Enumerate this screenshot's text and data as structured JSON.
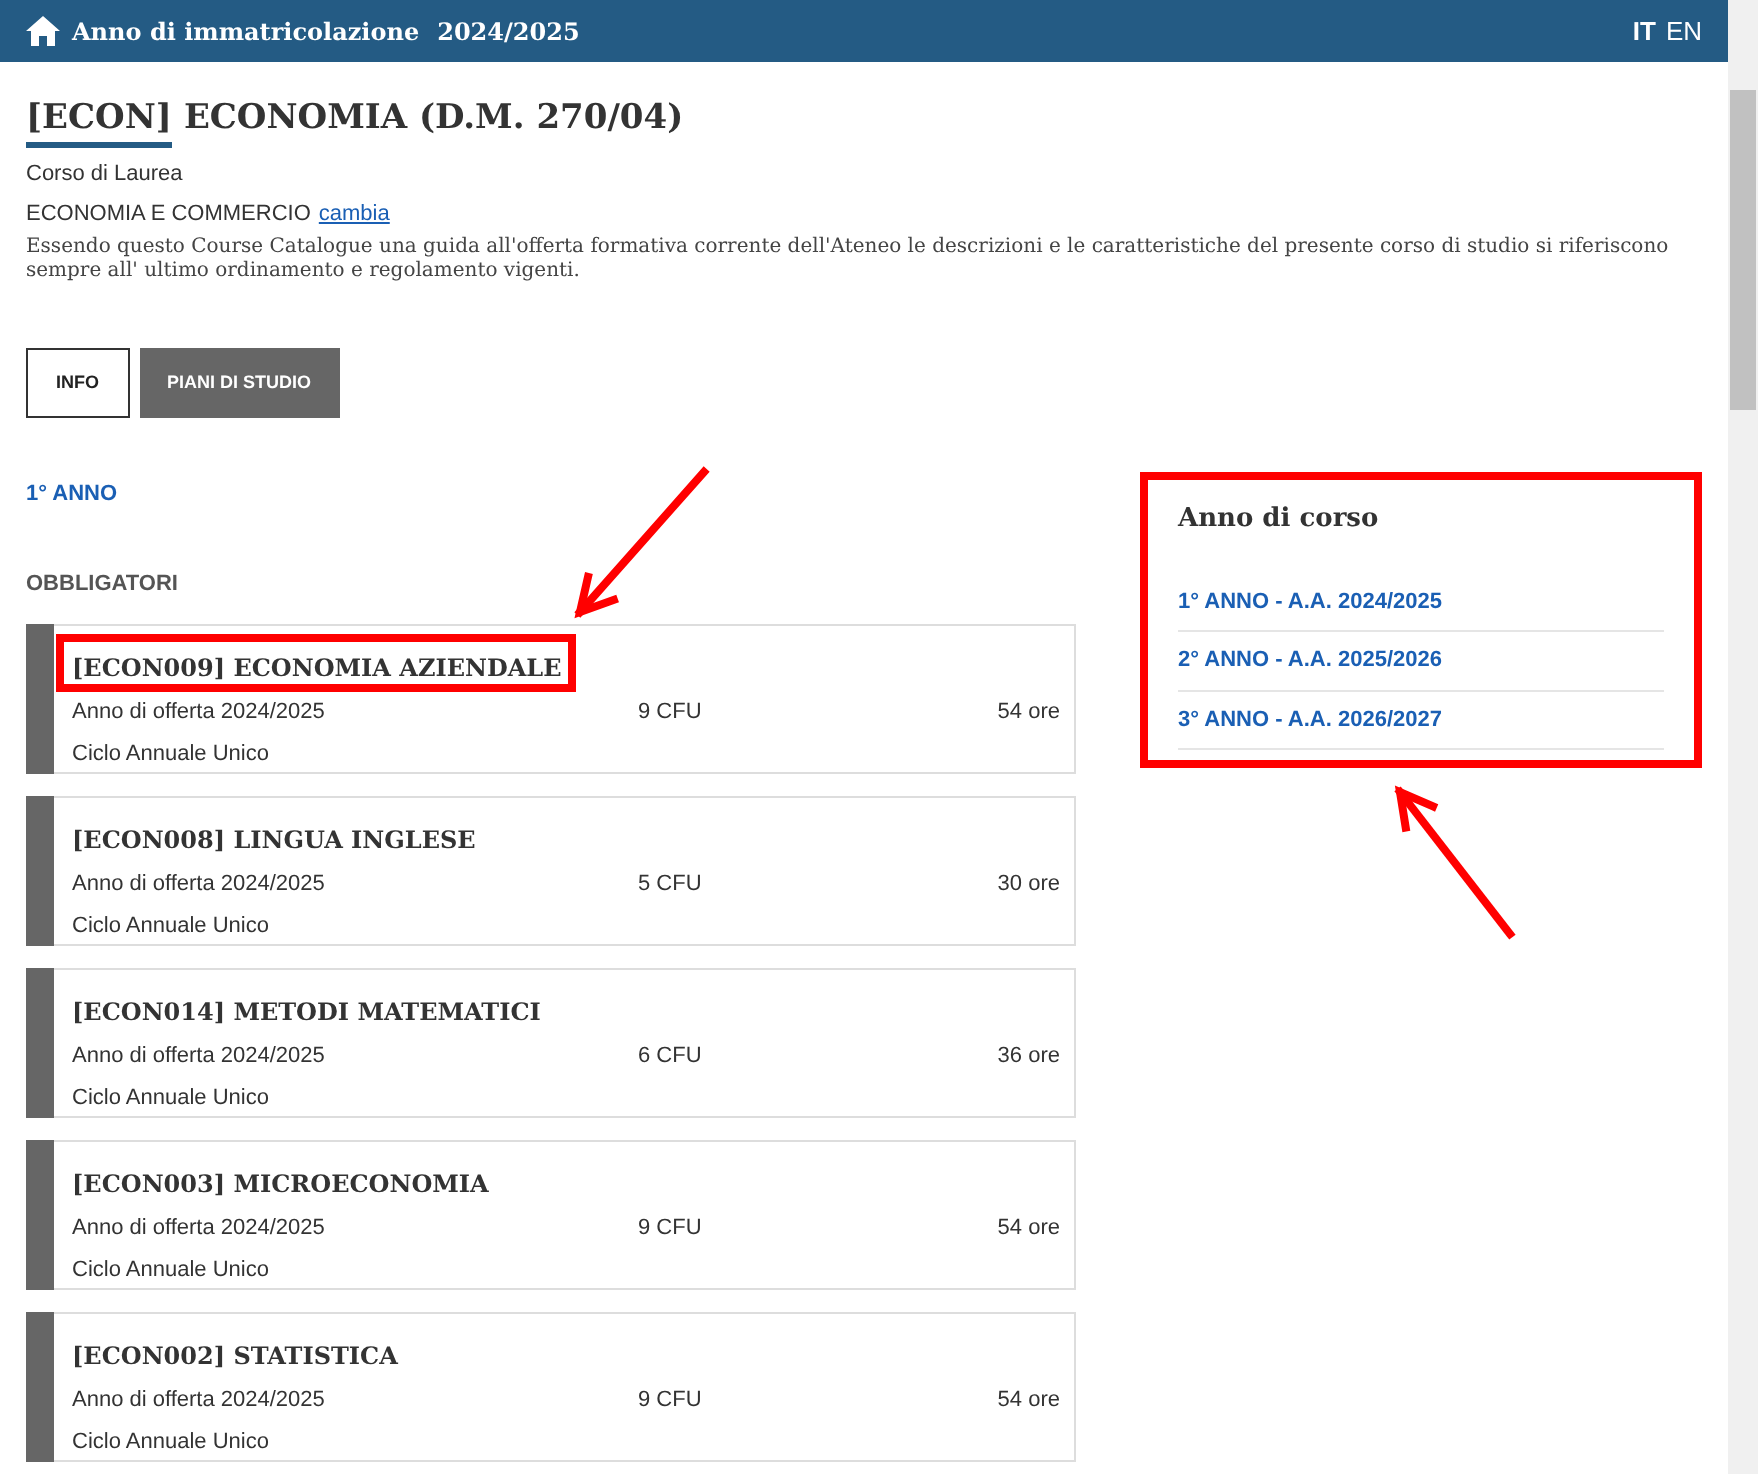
{
  "header": {
    "label": "Anno di immatricolazione",
    "year": "2024/2025",
    "languages": [
      {
        "label": "IT",
        "selected": true
      },
      {
        "label": "EN",
        "selected": false
      }
    ]
  },
  "title": {
    "code": "[ECON]",
    "name": "ECONOMIA (D.M. 270/04)"
  },
  "degree_type": "Corso di Laurea",
  "program": {
    "name": "ECONOMIA E COMMERCIO",
    "link": "cambia"
  },
  "description": "Essendo questo Course Catalogue una guida all'offerta formativa corrente dell'Ateneo le descrizioni e le caratteristiche del presente corso di studio si riferiscono sempre all' ultimo ordinamento e regolamento vigenti.",
  "tabs": [
    {
      "label": "INFO",
      "selected": false
    },
    {
      "label": "PIANI DI STUDIO",
      "selected": true
    }
  ],
  "year_heading": "1° ANNO",
  "section_heading": "OBBLIGATORI",
  "courses": [
    {
      "title": "[ECON009] ECONOMIA AZIENDALE",
      "offer": "Anno di offerta 2024/2025",
      "cfu": "9 CFU",
      "hours": "54 ore",
      "cycle": "Ciclo Annuale Unico",
      "highlighted": true
    },
    {
      "title": "[ECON008] LINGUA INGLESE",
      "offer": "Anno di offerta 2024/2025",
      "cfu": "5 CFU",
      "hours": "30 ore",
      "cycle": "Ciclo Annuale Unico",
      "highlighted": false
    },
    {
      "title": "[ECON014] METODI MATEMATICI",
      "offer": "Anno di offerta 2024/2025",
      "cfu": "6 CFU",
      "hours": "36 ore",
      "cycle": "Ciclo Annuale Unico",
      "highlighted": false
    },
    {
      "title": "[ECON003] MICROECONOMIA",
      "offer": "Anno di offerta 2024/2025",
      "cfu": "9 CFU",
      "hours": "54 ore",
      "cycle": "Ciclo Annuale Unico",
      "highlighted": false
    },
    {
      "title": "[ECON002] STATISTICA",
      "offer": "Anno di offerta 2024/2025",
      "cfu": "9 CFU",
      "hours": "54 ore",
      "cycle": "Ciclo Annuale Unico",
      "highlighted": false
    }
  ],
  "sidebar": {
    "title": "Anno di corso",
    "highlighted": true,
    "items": [
      "1° ANNO - A.A. 2024/2025",
      "2° ANNO - A.A. 2025/2026",
      "3° ANNO - A.A. 2026/2027"
    ]
  }
}
